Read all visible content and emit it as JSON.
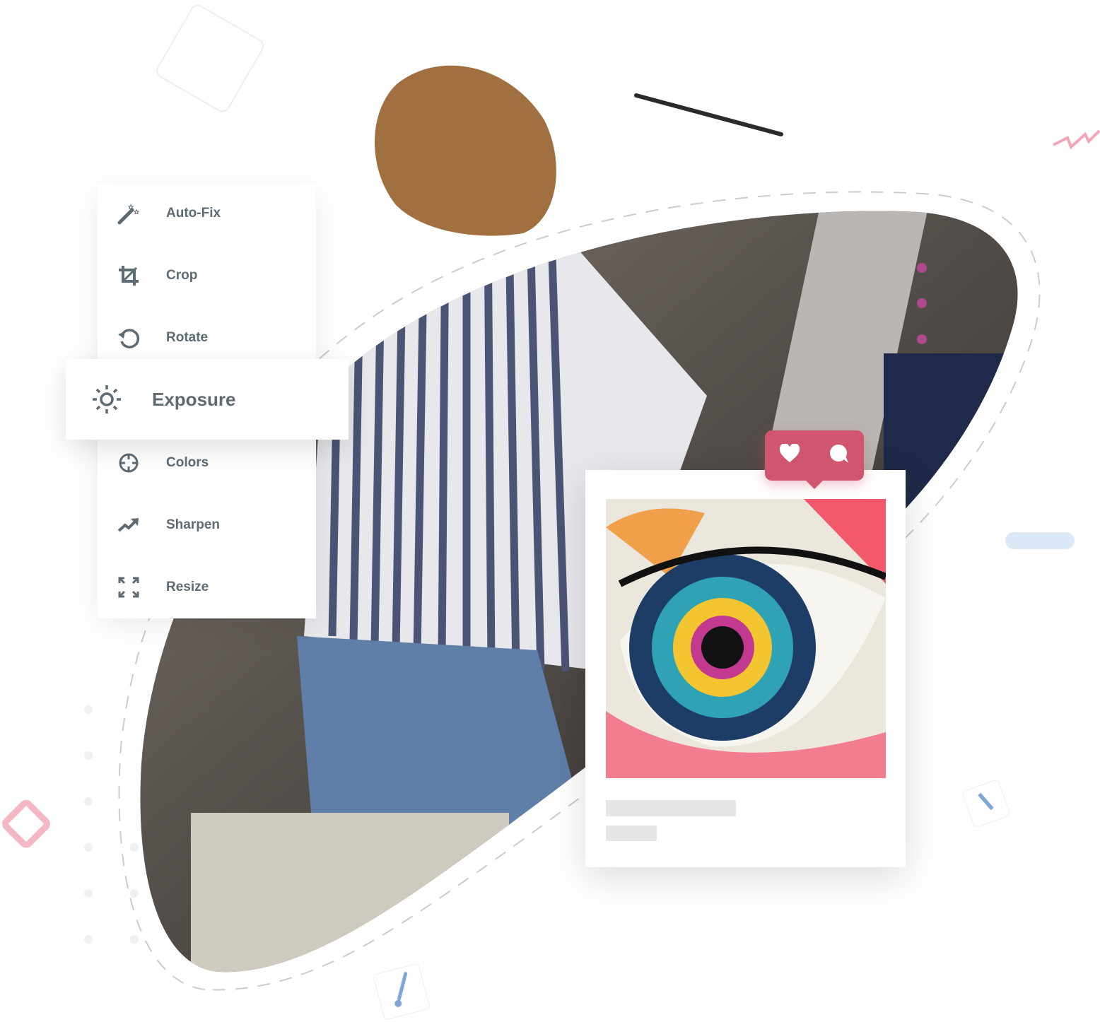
{
  "menu": {
    "items": [
      {
        "label": "Auto-Fix",
        "icon": "magic-wand-icon"
      },
      {
        "label": "Crop",
        "icon": "crop-icon"
      },
      {
        "label": "Rotate",
        "icon": "rotate-icon"
      },
      {
        "label": "Exposure",
        "icon": "sun-icon",
        "active": true
      },
      {
        "label": "Colors",
        "icon": "crosshair-icon"
      },
      {
        "label": "Sharpen",
        "icon": "trending-up-icon"
      },
      {
        "label": "Resize",
        "icon": "expand-icon"
      }
    ]
  },
  "post": {
    "reactions": [
      "heart-icon",
      "comment-icon"
    ],
    "image": "colorful painted eye artwork"
  },
  "colors": {
    "text": "#5f6b73",
    "badge": "#d0566f",
    "accent_pink": "#f4a6b8",
    "accent_blue": "#dbe9f7",
    "accent_purple": "#b0478f"
  }
}
